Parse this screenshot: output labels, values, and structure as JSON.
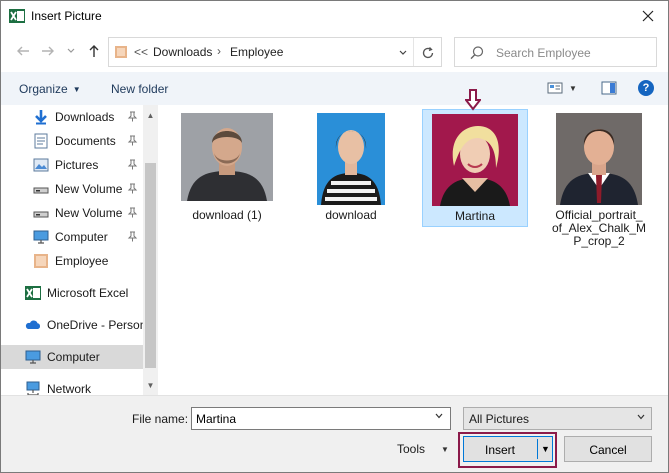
{
  "window": {
    "title": "Insert Picture",
    "app_icon": "excel-icon",
    "close_icon": "close-icon"
  },
  "address": {
    "lead": "<<",
    "crumbs": [
      "Downloads",
      "Employee"
    ],
    "separator": "›"
  },
  "search": {
    "placeholder": "Search Employee"
  },
  "toolbar": {
    "organize": "Organize",
    "new_folder": "New folder"
  },
  "sidebar": {
    "items": [
      {
        "label": "Downloads",
        "icon": "download-arrow-icon",
        "pinned": true
      },
      {
        "label": "Documents",
        "icon": "documents-icon",
        "pinned": true
      },
      {
        "label": "Pictures",
        "icon": "pictures-icon",
        "pinned": true
      },
      {
        "label": "New Volume",
        "icon": "drive-icon",
        "pinned": true
      },
      {
        "label": "New Volume",
        "icon": "drive-icon",
        "pinned": true
      },
      {
        "label": "Computer",
        "icon": "computer-icon",
        "pinned": true
      },
      {
        "label": "Employee",
        "icon": "folder-icon",
        "pinned": false
      },
      {
        "label": "Microsoft Excel",
        "icon": "excel-icon",
        "pinned": false
      },
      {
        "label": "OneDrive - Person",
        "icon": "onedrive-icon",
        "pinned": false
      },
      {
        "label": "Computer",
        "icon": "computer-icon",
        "pinned": false,
        "selected": true
      },
      {
        "label": "Network",
        "icon": "network-icon",
        "pinned": false
      }
    ]
  },
  "files": [
    {
      "name_lines": [
        "download (1)"
      ],
      "selected": false
    },
    {
      "name_lines": [
        "download"
      ],
      "selected": false
    },
    {
      "name_lines": [
        "Martina"
      ],
      "selected": true
    },
    {
      "name_lines": [
        "Official_portrait_",
        "of_Alex_Chalk_M",
        "P_crop_2"
      ],
      "selected": false
    }
  ],
  "footer": {
    "file_name_label": "File name:",
    "file_name_value": "Martina",
    "file_type": "All Pictures",
    "tools": "Tools",
    "insert": "Insert",
    "cancel": "Cancel"
  },
  "colors": {
    "accent": "#0078d7",
    "highlight_outline": "#8b1a4a",
    "selected_tile": "#cce8ff",
    "command_text": "#1e395b"
  }
}
